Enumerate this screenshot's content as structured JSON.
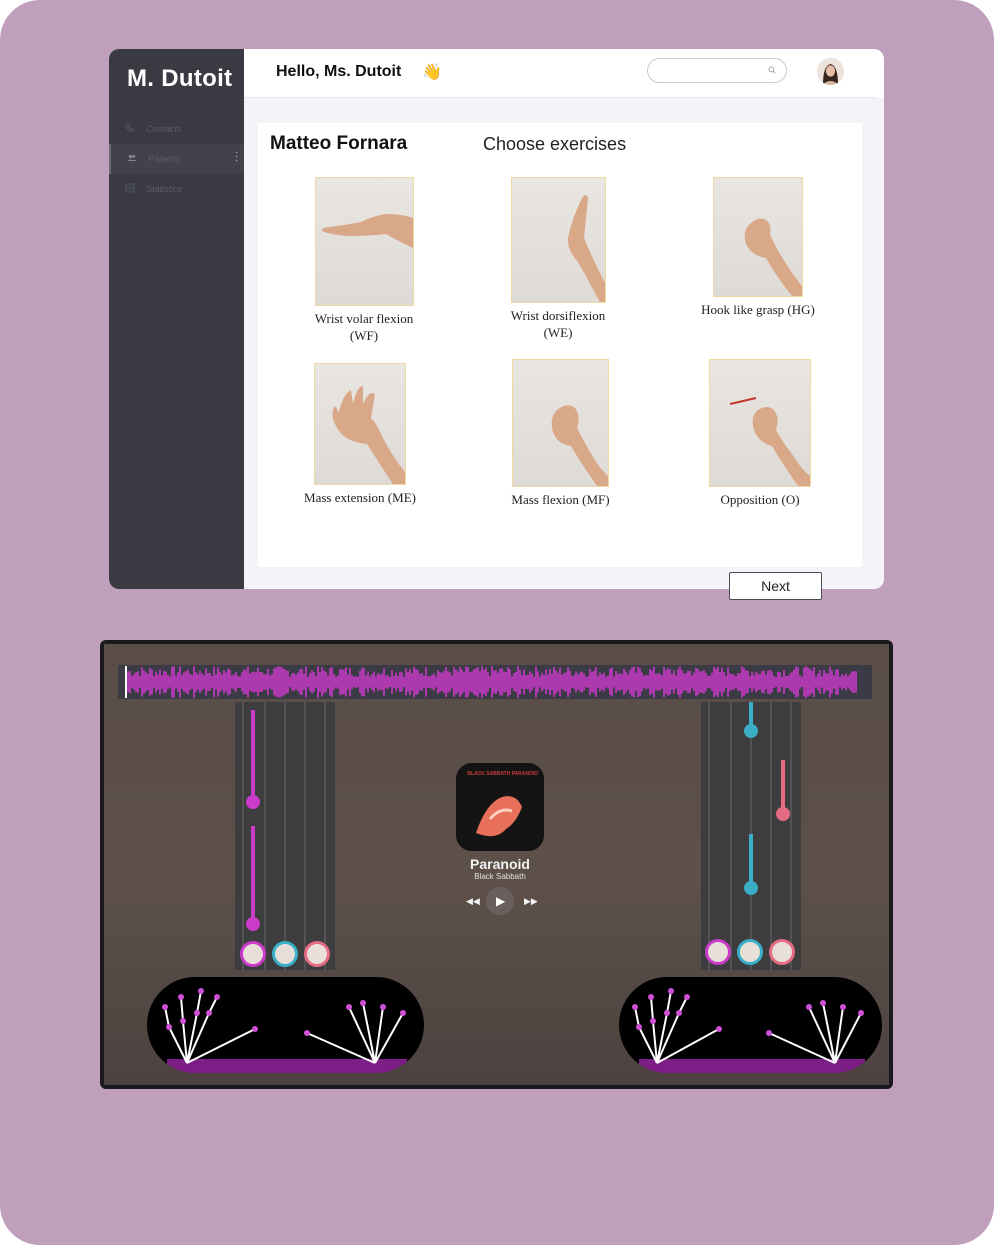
{
  "dashboard": {
    "brand": "M. Dutoit",
    "nav": [
      {
        "label": "Contacts",
        "icon": "phone-icon"
      },
      {
        "label": "Patients",
        "icon": "users-icon"
      },
      {
        "label": "Statistics",
        "icon": "chart-icon"
      }
    ],
    "greeting": "Hello, Ms. Dutoit",
    "greeting_emoji": "👋",
    "search": {
      "placeholder": "",
      "icon": "search-icon"
    },
    "patient_name": "Matteo Fornara",
    "section_title": "Choose exercises",
    "exercises": [
      {
        "label": "Wrist  volar flexion",
        "code": "(WF)"
      },
      {
        "label": "Wrist  dorsiflexion",
        "code": "(WE)"
      },
      {
        "label": "Hook like grasp (HG)",
        "code": ""
      },
      {
        "label": "Mass extension (ME)",
        "code": ""
      },
      {
        "label": "Mass flexion (MF)",
        "code": ""
      },
      {
        "label": "Opposition (O)",
        "code": ""
      }
    ],
    "next_label": "Next"
  },
  "game": {
    "song_title": "Paranoid",
    "artist": "Black Sabbath",
    "album_text": "BLACK SABBATH PARANOID",
    "colors": {
      "magenta": "#c93bc8",
      "cyan": "#3aaec6",
      "pink": "#e36b82"
    }
  }
}
